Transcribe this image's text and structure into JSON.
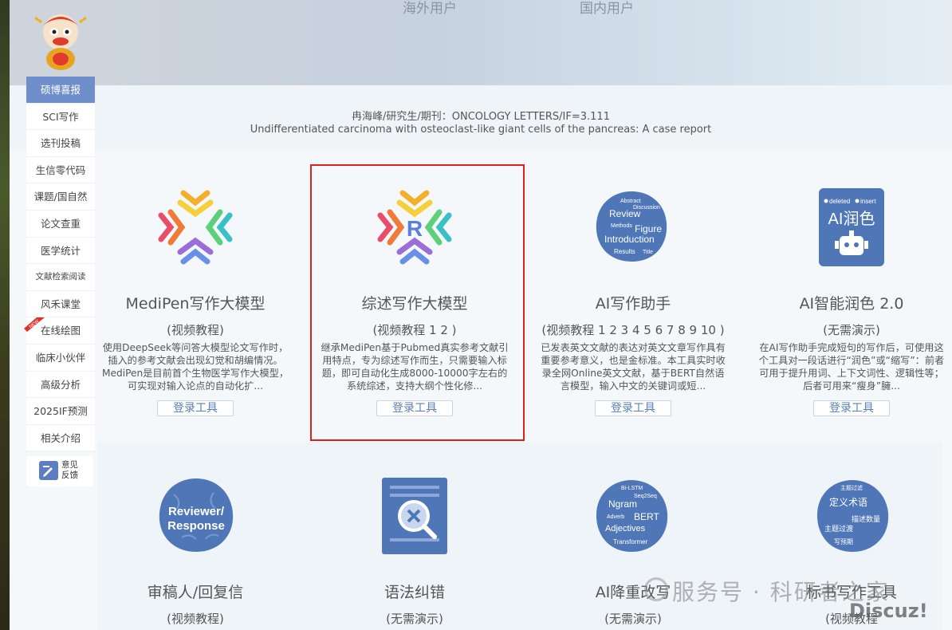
{
  "banner": {
    "overseas": "海外用户",
    "domestic": "国内用户"
  },
  "info": {
    "line1": "冉海峰/研究生/期刊：ONCOLOGY LETTERS/IF=3.111",
    "line2": "Undifferentiated carcinoma with osteoclast-like giant cells of the pancreas: A case report"
  },
  "sidebar": {
    "items": [
      {
        "label": "硕博喜报"
      },
      {
        "label": "SCI写作"
      },
      {
        "label": "选刊投稿"
      },
      {
        "label": "生信零代码"
      },
      {
        "label": "课题/国自然"
      },
      {
        "label": "论文查重"
      },
      {
        "label": "医学统计"
      },
      {
        "label": "文献检索阅读"
      },
      {
        "label": "风禾课堂"
      },
      {
        "label": "在线绘图"
      },
      {
        "label": "临床小伙伴"
      },
      {
        "label": "高级分析"
      },
      {
        "label": "2025IF预测"
      },
      {
        "label": "相关介绍"
      }
    ],
    "new_badge": "NEW",
    "feedback": "意见反馈"
  },
  "cards": [
    {
      "title": "MediPen写作大模型",
      "subtitle": "(视频教程)",
      "desc": "使用DeepSeek等问答大模型论文写作时，插入的参考文献会出现幻觉和胡编情况。MediPen是目前首个生物医学写作大模型，可实现对输入论点的自动化扩...",
      "button": "登录工具"
    },
    {
      "title": "综述写作大模型",
      "subtitle": "(视频教程 1 2 )",
      "desc": "继承MediPen基于Pubmed真实参考文献引用特点，专为综述写作而生，只需要输入标题，即可自动化生成8000-10000字左右的系统综述，支持大纲个性化修...",
      "button": "登录工具",
      "icon_letter": "R"
    },
    {
      "title": "AI写作助手",
      "subtitle": "(视频教程 1 2 3 4 5 6 7 8 9 10 )",
      "desc": "已发表英文文献的表达对英文文章写作具有重要参考意义，也是金标准。本工具实时收录全网Online英文文献，基于BERT自然语言模型，输入中文的关键词或短...",
      "button": "登录工具",
      "icon_words": [
        "Abstract",
        "Discussion",
        "Review",
        "Methods",
        "Figure",
        "Introduction",
        "Results",
        "Title"
      ]
    },
    {
      "title": "AI智能润色 2.0",
      "subtitle": "(无需演示)",
      "desc": "在AI写作助手完成短句的写作后，可使用这个工具对一段话进行“润色”或“缩写”：前者可用于提升用词、上下文词性、逻辑性等；后者可用来“瘦身”臃...",
      "button": "登录工具",
      "icon_text": "AI润色",
      "icon_tags": [
        "deleted",
        "insert"
      ]
    },
    {
      "title": "审稿人/回复信",
      "subtitle": "(视频教程)",
      "icon_text1": "Reviewer/",
      "icon_text2": "Response"
    },
    {
      "title": "语法纠错",
      "subtitle": "(无需演示)"
    },
    {
      "title": "AI降重改写",
      "subtitle": "(无需演示)",
      "icon_words": [
        "Bi-LSTM",
        "Seq2Seq",
        "Ngram",
        "Adverb",
        "BERT",
        "Adjectives",
        "Transformer"
      ]
    },
    {
      "title": "标书写作工具",
      "subtitle": "(视频教程",
      "icon_words": [
        "主题过滤",
        "定义术语",
        "描述数量",
        "主题过渡",
        "写预期"
      ]
    }
  ],
  "watermark": {
    "text": "服务号 · 科研者之家",
    "site": "Discuz!"
  }
}
